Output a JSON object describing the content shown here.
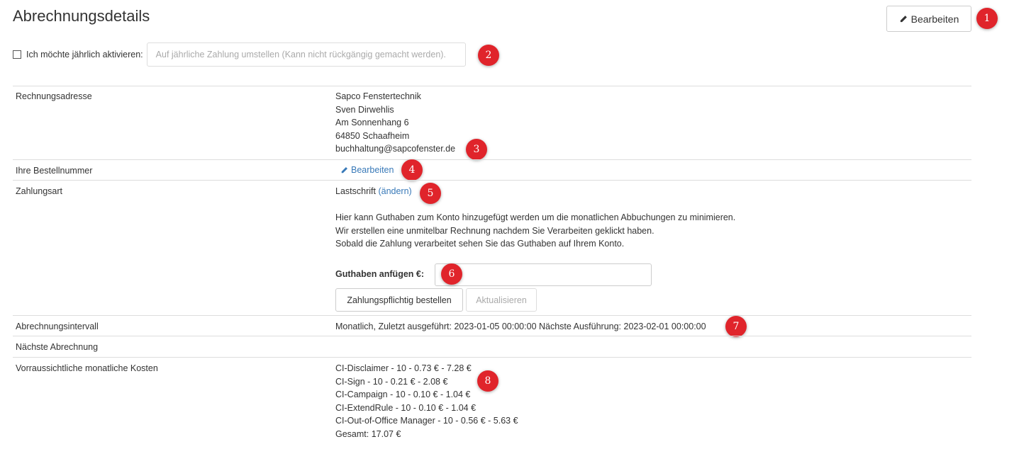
{
  "page": {
    "title": "Abrechnungsdetails",
    "edit_button_label": "Bearbeiten"
  },
  "annual": {
    "label": "Ich möchte jährlich aktivieren:",
    "checked": false,
    "placeholder": "Auf jährliche Zahlung umstellen (Kann nicht rückgängig gemacht werden)."
  },
  "badges": [
    "1",
    "2",
    "3",
    "4",
    "5",
    "6",
    "7",
    "8"
  ],
  "billing_address": {
    "label": "Rechnungsadresse",
    "lines": [
      "Sapco Fenstertechnik",
      "Sven Dirwehlis",
      "Am Sonnenhang 6",
      "64850 Schaafheim",
      "buchhaltung@sapcofenster.de"
    ]
  },
  "order_number": {
    "label": "Ihre Bestellnummer",
    "edit_link": "Bearbeiten"
  },
  "payment": {
    "label": "Zahlungsart",
    "method": "Lastschrift",
    "change_link": "(ändern)",
    "info_lines": [
      "Hier kann Guthaben zum Konto hinzugefügt werden um die monatlichen Abbuchungen zu minimieren.",
      "Wir erstellen eine unmitelbar Rechnung nachdem Sie Verarbeiten geklickt haben.",
      "Sobald die Zahlung verarbeitet sehen Sie das Guthaben auf Ihrem Konto."
    ],
    "credit_label": "Guthaben anfügen €:",
    "credit_value": "",
    "order_button": "Zahlungspflichtig bestellen",
    "update_button": "Aktualisieren"
  },
  "interval": {
    "label": "Abrechnungsintervall",
    "value": "Monatlich, Zuletzt ausgeführt: 2023-01-05 00:00:00 Nächste Ausführung: 2023-02-01 00:00:00"
  },
  "next_billing": {
    "label": "Nächste Abrechnung",
    "value": ""
  },
  "costs": {
    "label": "Vorraussichtliche monatliche Kosten",
    "lines": [
      "CI-Disclaimer - 10 - 0.73 € - 7.28 €",
      "CI-Sign - 10 - 0.21 € - 2.08 €",
      "CI-Campaign - 10 - 0.10 € - 1.04 €",
      "CI-ExtendRule - 10 - 0.10 € - 1.04 €",
      "CI-Out-of-Office Manager - 10 - 0.56 € - 5.63 €",
      "Gesamt: 17.07 €"
    ]
  },
  "icons": {
    "edit": "pencil-icon"
  },
  "colors": {
    "badge": "#e0242b",
    "link": "#3879b8",
    "border": "#dddddd"
  }
}
